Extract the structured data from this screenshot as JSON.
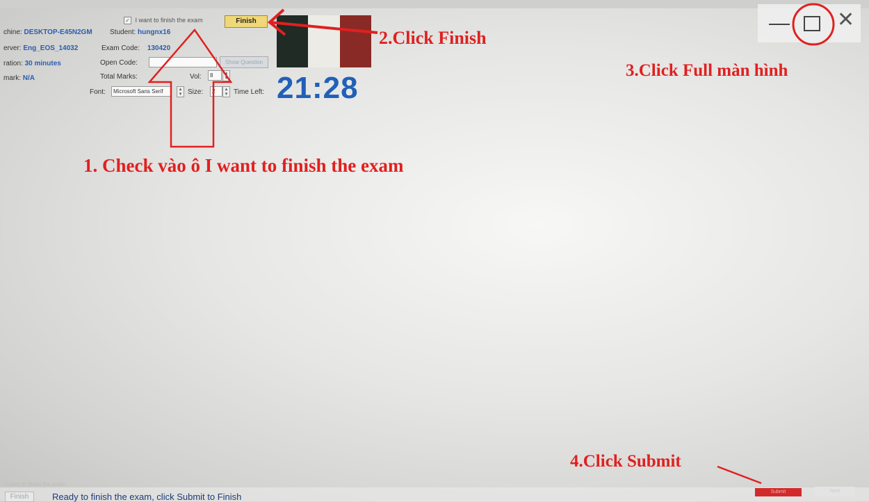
{
  "exam": {
    "machine_label": "chine:",
    "machine_value": "DESKTOP-E45N2GM",
    "student_label": "Student:",
    "student_value": "hungnx16",
    "server_label": "erver:",
    "server_value": "Eng_EOS_14032",
    "exam_code_label": "Exam Code:",
    "exam_code_value": "130420",
    "duration_label": "ration:",
    "duration_value": "30 minutes",
    "open_code_label": "Open Code:",
    "open_code_value": "",
    "show_question_label": "Show Question",
    "mark_label": "mark:",
    "mark_value": "N/A",
    "total_marks_label": "Total Marks:",
    "vol_label": "Vol:",
    "vol_value": "8",
    "font_label": "Font:",
    "font_value": "Microsoft Sans Serif",
    "size_label": "Size:",
    "size_value": "2",
    "time_left_label": "Time Left:",
    "time_left_value": "21:28",
    "finish_checkbox_label": "I want to finish the exam",
    "finish_button_label": "Finish",
    "flag_colors": [
      "#1f2b24",
      "#ecebe6",
      "#8a2a26"
    ]
  },
  "annotations": {
    "step1": "1. Check vào ô I want to finish the exam",
    "step2": "2.Click Finish",
    "step3": "3.Click Full màn hình",
    "step4": "4.Click Submit",
    "color": "#e02020"
  },
  "window_controls": {
    "minimize_icon": "minimize-icon",
    "maximize_icon": "maximize-icon",
    "close_icon": "close-icon"
  },
  "status_bar": {
    "note": "I want to finish the exam",
    "finish_label": "Finish",
    "message": "Ready to finish the exam, click Submit to Finish",
    "submit_label": "Submit",
    "next_label": "Next"
  }
}
